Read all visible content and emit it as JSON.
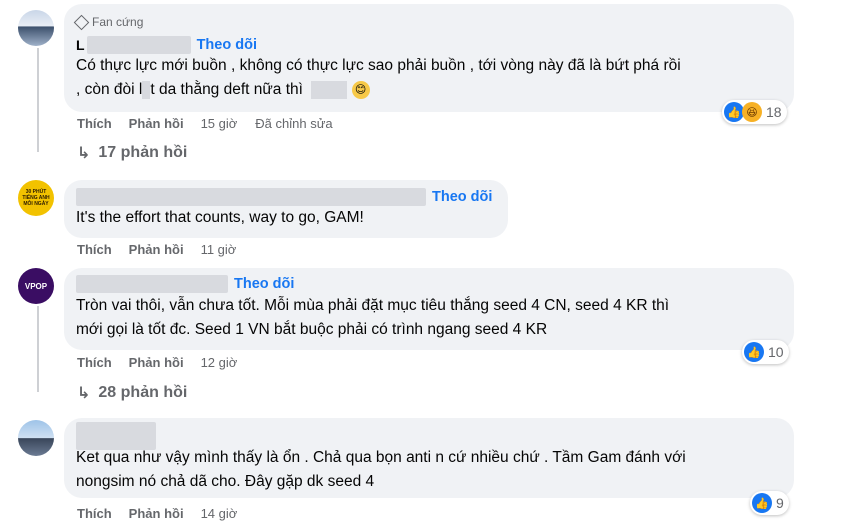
{
  "comments": [
    {
      "badge": "Fan cứng",
      "author_initial": "L",
      "follow": "Theo dõi",
      "lines": [
        "Có thực lực mới buồn , không có thực lực sao phải buồn , tới vòng này đã là bứt phá rồi",
        ", còn đòi l",
        "t da thằng deft nữa thì"
      ],
      "emoji": "😊",
      "reactions": {
        "count": "18",
        "icons": [
          "like-icon",
          "haha-icon"
        ]
      },
      "actions": {
        "like": "Thích",
        "reply": "Phản hồi",
        "time": "15 giờ",
        "edited": "Đã chỉnh sửa"
      },
      "replies": "17 phản hồi"
    },
    {
      "avatar_text": "30 PHÚT TIẾNG ANH MỖI NGÀY",
      "follow": "Theo dõi",
      "lines": [
        "It's the effort that counts, way to go, GAM!"
      ],
      "actions": {
        "like": "Thích",
        "reply": "Phản hồi",
        "time": "11 giờ"
      }
    },
    {
      "avatar_text": "VPOP",
      "follow": "Theo dõi",
      "lines": [
        "Tròn vai thôi, vẫn chưa tốt. Mỗi mùa phải đặt mục tiêu thắng seed 4 CN, seed 4 KR thì",
        "mới gọi là tốt đc. Seed 1 VN bắt buộc phải có trình ngang seed 4 KR"
      ],
      "reactions": {
        "count": "10",
        "icons": [
          "like-icon"
        ]
      },
      "actions": {
        "like": "Thích",
        "reply": "Phản hồi",
        "time": "12 giờ"
      },
      "replies": "28 phản hồi"
    },
    {
      "lines": [
        "Ket qua như vậy mình thấy là ổn . Chả qua bọn anti n cứ nhiều chứ . Tầm Gam đánh với",
        "nongsim nó chả dã cho. Đây gặp dk seed 4"
      ],
      "reactions": {
        "count": "9",
        "icons": [
          "like-icon"
        ]
      },
      "actions": {
        "like": "Thích",
        "reply": "Phản hồi",
        "time": "14 giờ"
      }
    }
  ]
}
